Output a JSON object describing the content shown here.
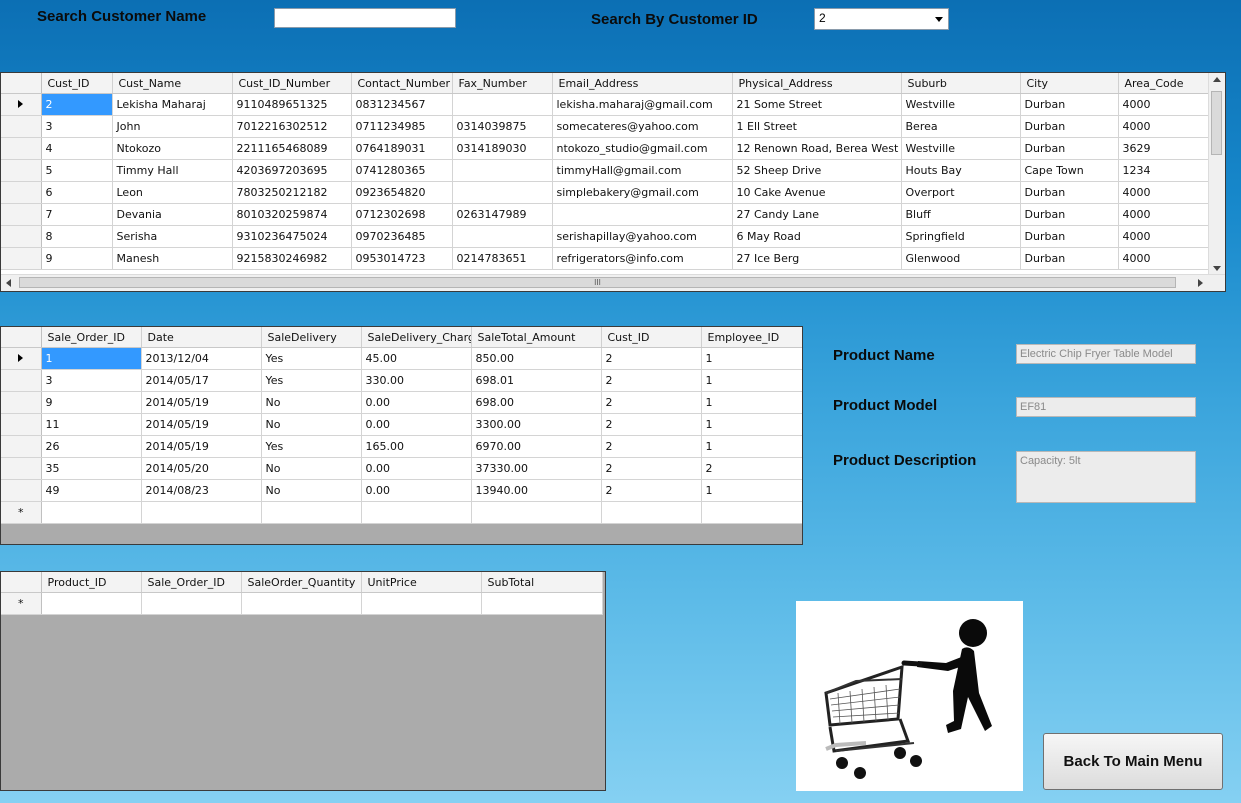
{
  "search": {
    "name_label": "Search Customer Name",
    "name_value": "",
    "id_label": "Search By Customer ID",
    "id_value": "2"
  },
  "customers": {
    "columns": [
      "Cust_ID",
      "Cust_Name",
      "Cust_ID_Number",
      "Contact_Number",
      "Fax_Number",
      "Email_Address",
      "Physical_Address",
      "Suburb",
      "City",
      "Area_Code"
    ],
    "rows": [
      [
        "2",
        "Lekisha Maharaj",
        "9110489651325",
        "0831234567",
        "",
        "lekisha.maharaj@gmail.com",
        "21 Some Street",
        "Westville",
        "Durban",
        "4000"
      ],
      [
        "3",
        "John",
        "7012216302512",
        "0711234985",
        "0314039875",
        "somecateres@yahoo.com",
        "1 Ell Street",
        "Berea",
        "Durban",
        "4000"
      ],
      [
        "4",
        "Ntokozo",
        "2211165468089",
        "0764189031",
        "0314189030",
        "ntokozo_studio@gmail.com",
        "12 Renown Road, Berea West",
        "Westville",
        "Durban",
        "3629"
      ],
      [
        "5",
        "Timmy Hall",
        "4203697203695",
        "0741280365",
        "",
        "timmyHall@gmail.com",
        "52 Sheep Drive",
        "Houts Bay",
        "Cape Town",
        "1234"
      ],
      [
        "6",
        "Leon",
        "7803250212182",
        "0923654820",
        "",
        "simplebakery@gmail.com",
        "10 Cake Avenue",
        "Overport",
        "Durban",
        "4000"
      ],
      [
        "7",
        "Devania",
        "8010320259874",
        "0712302698",
        "0263147989",
        "",
        "27 Candy Lane",
        "Bluff",
        "Durban",
        "4000"
      ],
      [
        "8",
        "Serisha",
        "9310236475024",
        "0970236485",
        "",
        "serishapillay@yahoo.com",
        "6 May Road",
        "Springfield",
        "Durban",
        "4000"
      ],
      [
        "9",
        "Manesh",
        "9215830246982",
        "0953014723",
        "0214783651",
        "refrigerators@info.com",
        "27 Ice Berg",
        "Glenwood",
        "Durban",
        "4000"
      ]
    ],
    "scroll_mark": "III"
  },
  "orders": {
    "columns": [
      "Sale_Order_ID",
      "Date",
      "SaleDelivery",
      "SaleDelivery_Charge",
      "SaleTotal_Amount",
      "Cust_ID",
      "Employee_ID"
    ],
    "rows": [
      [
        "1",
        "2013/12/04",
        "Yes",
        "45.00",
        "850.00",
        "2",
        "1"
      ],
      [
        "3",
        "2014/05/17",
        "Yes",
        "330.00",
        "698.01",
        "2",
        "1"
      ],
      [
        "9",
        "2014/05/19",
        "No",
        "0.00",
        "698.00",
        "2",
        "1"
      ],
      [
        "11",
        "2014/05/19",
        "No",
        "0.00",
        "3300.00",
        "2",
        "1"
      ],
      [
        "26",
        "2014/05/19",
        "Yes",
        "165.00",
        "6970.00",
        "2",
        "1"
      ],
      [
        "35",
        "2014/05/20",
        "No",
        "0.00",
        "37330.00",
        "2",
        "2"
      ],
      [
        "49",
        "2014/08/23",
        "No",
        "0.00",
        "13940.00",
        "2",
        "1"
      ]
    ],
    "new_row_marker": "*"
  },
  "lines": {
    "columns": [
      "Product_ID",
      "Sale_Order_ID",
      "SaleOrder_Quantity",
      "UnitPrice",
      "SubTotal"
    ],
    "new_row_marker": "*"
  },
  "product": {
    "name_label": "Product Name",
    "name_value": "Electric Chip Fryer Table Model",
    "model_label": "Product Model",
    "model_value": "EF81",
    "desc_label": "Product Description",
    "desc_value": "Capacity: 5lt"
  },
  "back_button": "Back To Main Menu",
  "icons": {
    "cart_image": "shopping-cart-person-icon",
    "row_selector": "triangle-right-icon"
  }
}
